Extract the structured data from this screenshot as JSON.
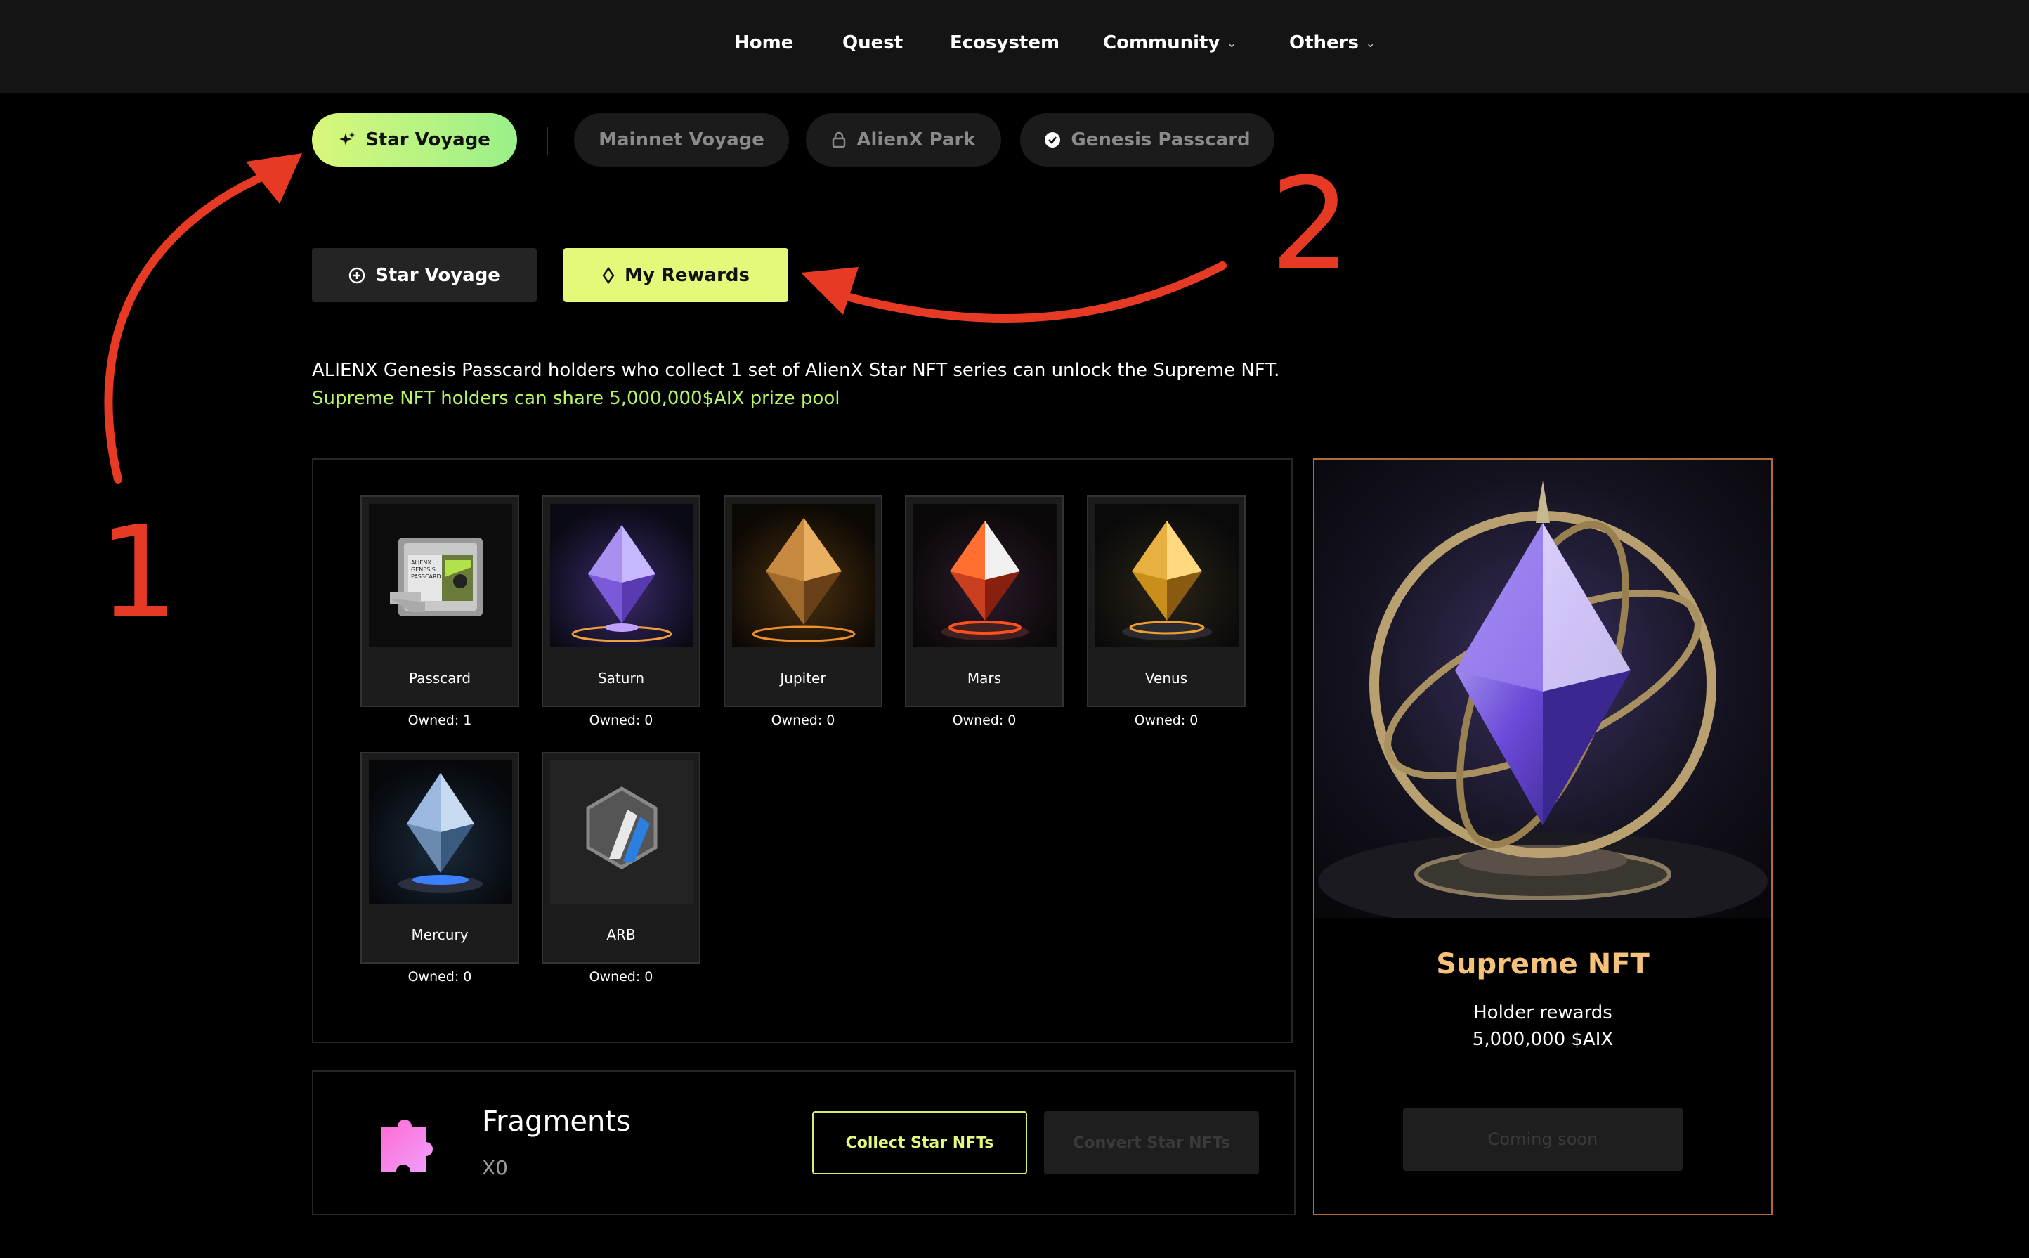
{
  "nav": {
    "items": [
      {
        "label": "Home",
        "has_dropdown": false
      },
      {
        "label": "Quest",
        "has_dropdown": false
      },
      {
        "label": "Ecosystem",
        "has_dropdown": false
      },
      {
        "label": "Community",
        "has_dropdown": true
      },
      {
        "label": "Others",
        "has_dropdown": true
      }
    ]
  },
  "primary_tabs": [
    {
      "label": "Star Voyage",
      "icon": "sparkle-icon",
      "active": true
    },
    {
      "label": "Mainnet Voyage",
      "icon": "",
      "active": false
    },
    {
      "label": "AlienX Park",
      "icon": "lock-icon",
      "active": false
    },
    {
      "label": "Genesis Passcard",
      "icon": "check-circle-icon",
      "active": false
    }
  ],
  "secondary_tabs": [
    {
      "label": "Star Voyage",
      "icon": "plus-circle-icon",
      "active": false
    },
    {
      "label": "My Rewards",
      "icon": "diamond-icon",
      "active": true
    }
  ],
  "description": {
    "line1": "ALIENX Genesis Passcard holders who collect 1 set of AlienX Star NFT series can unlock the Supreme NFT.",
    "line2": "Supreme NFT holders can share 5,000,000$AIX prize pool"
  },
  "nfts": [
    {
      "name": "Passcard",
      "owned": "Owned: 1"
    },
    {
      "name": "Saturn",
      "owned": "Owned: 0"
    },
    {
      "name": "Jupiter",
      "owned": "Owned: 0"
    },
    {
      "name": "Mars",
      "owned": "Owned: 0"
    },
    {
      "name": "Venus",
      "owned": "Owned: 0"
    },
    {
      "name": "Mercury",
      "owned": "Owned: 0"
    },
    {
      "name": "ARB",
      "owned": "Owned: 0"
    }
  ],
  "passcard_label": [
    "ALIENX",
    "GENESIS",
    "PASSCARD"
  ],
  "fragments": {
    "title": "Fragments",
    "count": "X0",
    "collect_label": "Collect Star NFTs",
    "convert_label": "Convert Star NFTs"
  },
  "supreme": {
    "title": "Supreme NFT",
    "subtitle": "Holder rewards",
    "amount": "5,000,000 $AIX",
    "button_label": "Coming soon"
  },
  "annotations": {
    "one": "1",
    "two": "2"
  },
  "colors": {
    "accent_lime": "#e4f97a",
    "accent_green": "#9af08a",
    "annotation_red": "#e63a25",
    "supreme_gold": "#f6c27a"
  }
}
